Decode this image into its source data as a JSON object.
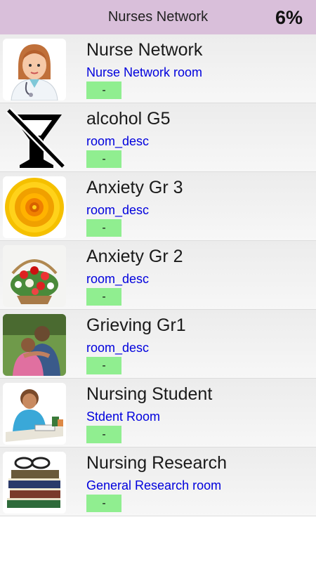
{
  "header": {
    "title": "Nurses Network",
    "percent": "6%"
  },
  "rooms": [
    {
      "title": "Nurse Network",
      "desc": "Nurse Network room",
      "badge": "-",
      "icon": "nurse-avatar-icon"
    },
    {
      "title": "alcohol G5",
      "desc": "room_desc",
      "badge": "-",
      "icon": "no-alcohol-icon"
    },
    {
      "title": "Anxiety Gr 3",
      "desc": "room_desc",
      "badge": "-",
      "icon": "sunflower-icon"
    },
    {
      "title": "Anxiety Gr 2",
      "desc": "room_desc",
      "badge": "-",
      "icon": "flower-basket-icon"
    },
    {
      "title": "Grieving Gr1",
      "desc": "room_desc",
      "badge": "-",
      "icon": "hug-photo-icon"
    },
    {
      "title": "Nursing Student",
      "desc": "Stdent Room",
      "badge": "-",
      "icon": "student-photo-icon"
    },
    {
      "title": "Nursing Research",
      "desc": "General Research room",
      "badge": "-",
      "icon": "books-icon"
    }
  ],
  "colors": {
    "header_bg": "#d9bfda",
    "badge_bg": "#90ee90",
    "desc_text": "#0000dd"
  }
}
